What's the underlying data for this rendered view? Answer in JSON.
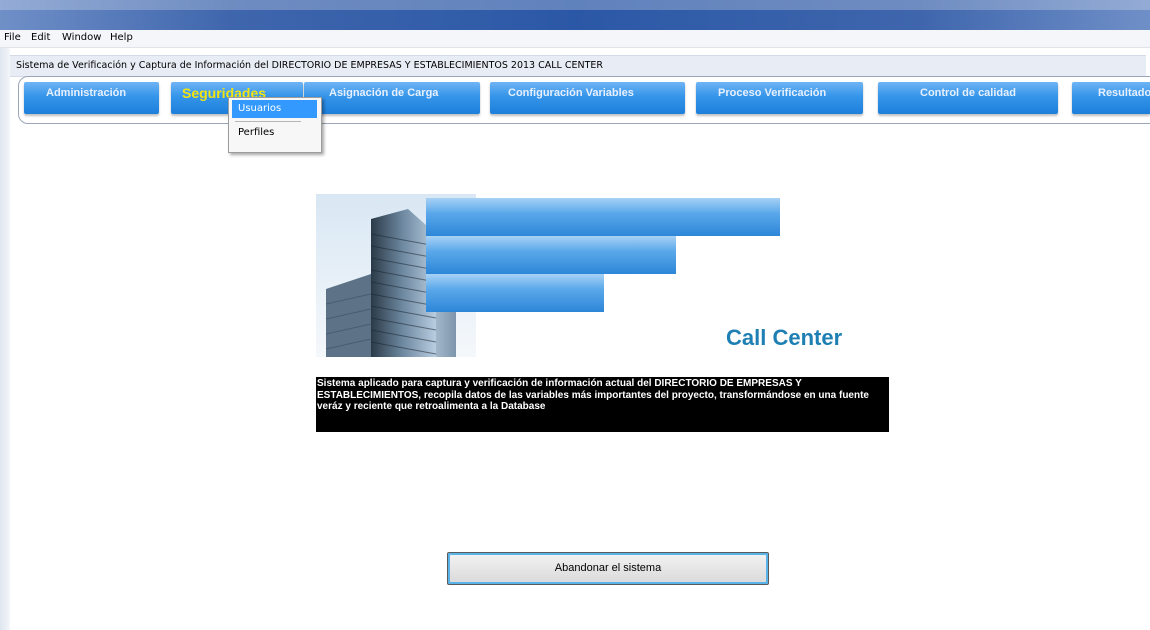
{
  "menubar": {
    "items": [
      "File",
      "Edit",
      "Window",
      "Help"
    ]
  },
  "title": "Sistema de Verificación y Captura de Información del DIRECTORIO DE EMPRESAS Y ESTABLECIMIENTOS 2013   CALL CENTER",
  "nav": {
    "items": [
      {
        "label": "Administración"
      },
      {
        "label": "Seguridades"
      },
      {
        "label": "Asignación de Carga"
      },
      {
        "label": "Configuración Variables"
      },
      {
        "label": "Proceso Verificación"
      },
      {
        "label": "Control de calidad"
      },
      {
        "label": "Resultados"
      }
    ],
    "active_index": 1
  },
  "dropdown": {
    "items": [
      "Usuarios",
      "Perfiles"
    ],
    "highlighted_index": 0
  },
  "banner": {
    "heading": "Call Center"
  },
  "description": "Sistema aplicado para captura y verificación de información actual del DIRECTORIO DE EMPRESAS Y ESTABLECIMIENTOS, recopila datos de las variables más importantes del proyecto, transformándose en una fuente veráz y reciente que retroalimenta a la Database",
  "exit_button": {
    "label": "Abandonar el sistema"
  },
  "colors": {
    "nav_blue": "#2a8ae0",
    "active_text": "#f3e410",
    "heading": "#1d7fb3",
    "highlight": "#3399ff"
  }
}
